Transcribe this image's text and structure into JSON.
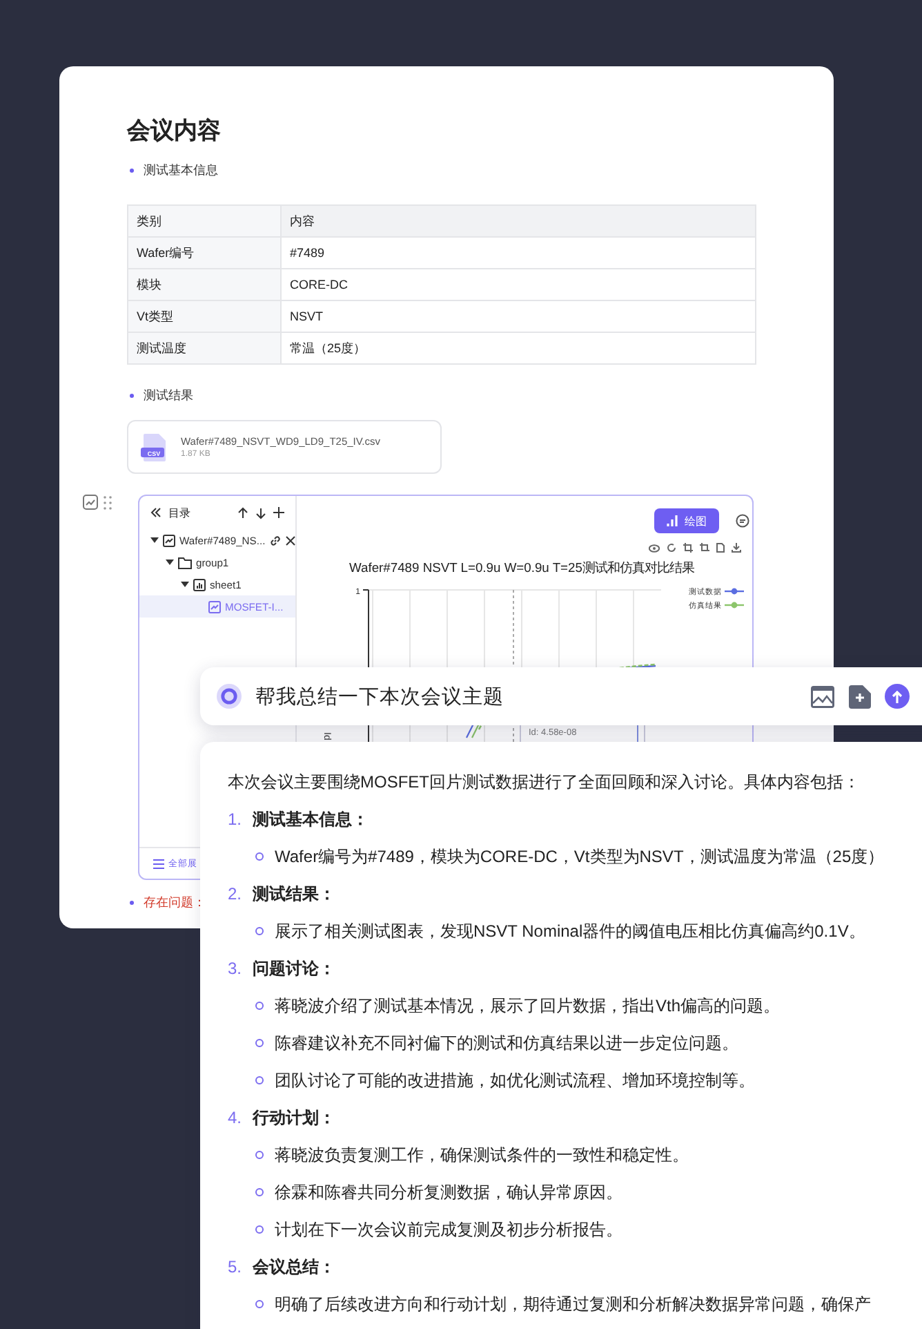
{
  "document": {
    "title": "会议内容"
  },
  "basic_info": {
    "bullet": "测试基本信息",
    "table": {
      "columns": [
        "类别",
        "内容"
      ],
      "rows": [
        [
          "Wafer编号",
          "#7489"
        ],
        [
          "模块",
          "CORE-DC"
        ],
        [
          "Vt类型",
          "NSVT"
        ],
        [
          "测试温度",
          "常温（25度）"
        ]
      ]
    }
  },
  "results": {
    "bullet": "测试结果",
    "file": {
      "type": "CSV",
      "name": "Wafer#7489_NSVT_WD9_LD9_T25_IV.csv",
      "size": "1.87 KB"
    }
  },
  "sheet_panel": {
    "tree_title": "目录",
    "tree": [
      {
        "label": "Wafer#7489_NS...",
        "kind": "file",
        "expanded": true,
        "selected": false,
        "children": [
          {
            "label": "group1",
            "kind": "folder",
            "expanded": true,
            "selected": false,
            "children": [
              {
                "label": "sheet1",
                "kind": "sheet",
                "expanded": true,
                "selected": false,
                "children": [
                  {
                    "label": "MOSFET-I...",
                    "kind": "chart",
                    "selected": true
                  }
                ]
              }
            ]
          }
        ]
      }
    ],
    "expand_all": "全部展",
    "plot_button": "绘图",
    "chart": {
      "title": "Wafer#7489 NSVT L=0.9u W=0.9u T=25测试和仿真对比结果",
      "y_tick": "1",
      "y_label": "Id",
      "tooltip": "Id: 4.58e-08",
      "legend": [
        {
          "name": "测试数据",
          "color": "#5b6ee1"
        },
        {
          "name": "仿真结果",
          "color": "#8cc56b"
        }
      ]
    }
  },
  "issues": {
    "bullet": "存在问题："
  },
  "prompt": {
    "value": "帮我总结一下本次会议主题"
  },
  "summary": {
    "intro": "本次会议主要围绕MOSFET回片测试数据进行了全面回顾和深入讨论。具体内容包括：",
    "items": [
      {
        "number": "1.",
        "title": "测试基本信息：",
        "points": [
          "Wafer编号为#7489，模块为CORE-DC，Vt类型为NSVT，测试温度为常温（25度）"
        ]
      },
      {
        "number": "2.",
        "title": "测试结果：",
        "points": [
          "展示了相关测试图表，发现NSVT Nominal器件的阈值电压相比仿真偏高约0.1V。"
        ]
      },
      {
        "number": "3.",
        "title": "问题讨论：",
        "points": [
          "蒋晓波介绍了测试基本情况，展示了回片数据，指出Vth偏高的问题。",
          "陈睿建议补充不同衬偏下的测试和仿真结果以进一步定位问题。",
          "团队讨论了可能的改进措施，如优化测试流程、增加环境控制等。"
        ]
      },
      {
        "number": "4.",
        "title": "行动计划：",
        "points": [
          "蒋晓波负责复测工作，确保测试条件的一致性和稳定性。",
          "徐霖和陈睿共同分析复测数据，确认异常原因。",
          "计划在下一次会议前完成复测及初步分析报告。"
        ]
      },
      {
        "number": "5.",
        "title": "会议总结：",
        "points": [
          "明确了后续改进方向和行动计划，期待通过复测和分析解决数据异常问题，确保产"
        ]
      }
    ]
  }
}
